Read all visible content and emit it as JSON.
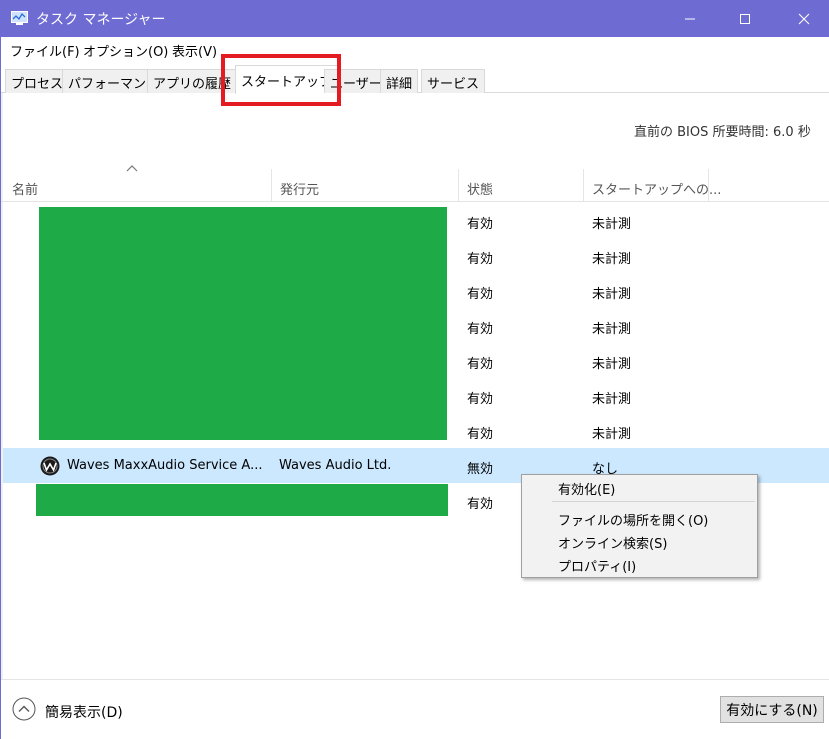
{
  "window": {
    "title": "タスク マネージャー",
    "title_bar_color": "#6e6bd3"
  },
  "menu": {
    "file": "ファイル(F)",
    "options": "オプション(O)",
    "view": "表示(V)"
  },
  "tabs": [
    {
      "label": "プロセス"
    },
    {
      "label": "パフォーマンス"
    },
    {
      "label": "アプリの履歴"
    },
    {
      "label": "スタートアップ"
    },
    {
      "label": "ユーザー"
    },
    {
      "label": "詳細"
    },
    {
      "label": "サービス"
    }
  ],
  "bios": {
    "label": "直前の BIOS 所要時間:",
    "value": "6.0 秒"
  },
  "table": {
    "headers": {
      "name": "名前",
      "publisher": "発行元",
      "status": "状態",
      "impact": "スタートアップへの..."
    },
    "rows": [
      {
        "status": "有効",
        "impact": "未計測"
      },
      {
        "status": "有効",
        "impact": "未計測"
      },
      {
        "status": "有効",
        "impact": "未計測"
      },
      {
        "status": "有効",
        "impact": "未計測"
      },
      {
        "status": "有効",
        "impact": "未計測"
      },
      {
        "status": "有効",
        "impact": "未計測"
      },
      {
        "status": "有効",
        "impact": "未計測"
      },
      {
        "name": "Waves MaxxAudio Service A...",
        "publisher": "Waves Audio Ltd.",
        "status": "無効",
        "impact": "なし",
        "icon": "waves-logo-icon"
      },
      {
        "status": "有効"
      }
    ]
  },
  "context_menu": {
    "enable": "有効化(E)",
    "open_file_location": "ファイルの場所を開く(O)",
    "search_online": "オンライン検索(S)",
    "properties": "プロパティ(I)"
  },
  "footer": {
    "fewer_details": "簡易表示(D)",
    "enable_button": "有効にする(N)"
  },
  "colors": {
    "highlight_box": "#e41b23",
    "selected_row": "#cce8ff",
    "redaction": "#1faa48"
  }
}
